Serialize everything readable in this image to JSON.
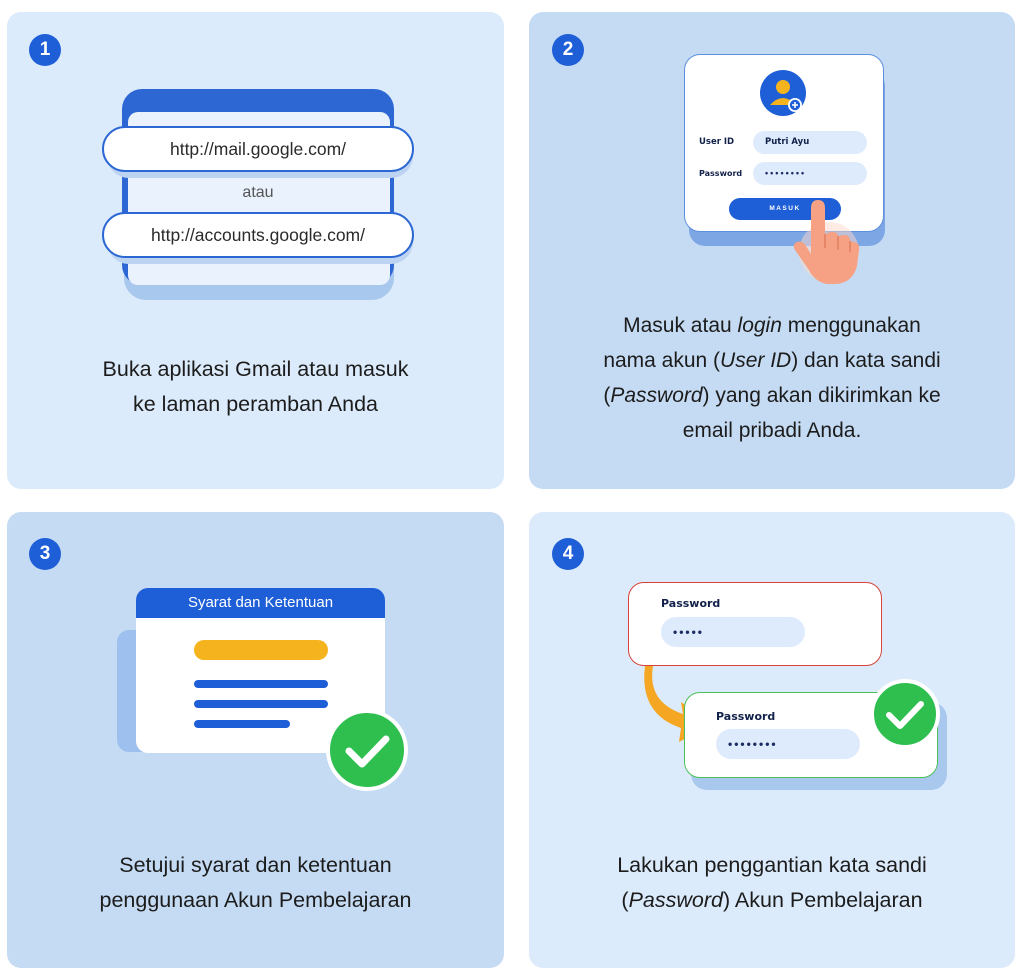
{
  "steps": [
    {
      "number": "1",
      "urls": [
        "http://mail.google.com/",
        "http://accounts.google.com/"
      ],
      "separator": "atau",
      "caption_lines": [
        "Buka aplikasi Gmail atau masuk",
        "ke laman peramban Anda"
      ]
    },
    {
      "number": "2",
      "form": {
        "user_label": "User ID",
        "user_value": "Putri Ayu",
        "password_label": "Password",
        "password_value": "••••••••",
        "button_label": "MASUK"
      },
      "caption": {
        "l1a": "Masuk atau ",
        "l1i": "login",
        "l1b": " menggunakan",
        "l2a": "nama akun (",
        "l2i": "User ID",
        "l2b": ") dan kata sandi",
        "l3a": "(",
        "l3i": "Password",
        "l3b": ") yang akan dikirimkan ke",
        "l4": "email pribadi Anda."
      }
    },
    {
      "number": "3",
      "card_title": "Syarat dan Ketentuan",
      "caption_lines": [
        "Setujui syarat dan ketentuan",
        "penggunaan Akun Pembelajaran"
      ]
    },
    {
      "number": "4",
      "old_label": "Password",
      "old_value": "•••••",
      "new_label": "Password",
      "new_value": "••••••••",
      "caption": {
        "l1": "Lakukan penggantian kata sandi",
        "l2a": "(",
        "l2i": "Password",
        "l2b": ") Akun Pembelajaran"
      }
    }
  ],
  "colors": {
    "primary": "#1e5fd8",
    "panel_light": "#dcebfb",
    "panel_dark": "#c5dbf3",
    "success": "#2fbf4f",
    "warning": "#f5b41e",
    "error_border": "#d9423a"
  },
  "icons": [
    "user-avatar-icon",
    "hand-pointer-icon",
    "checkmark-icon",
    "curved-arrow-icon"
  ]
}
